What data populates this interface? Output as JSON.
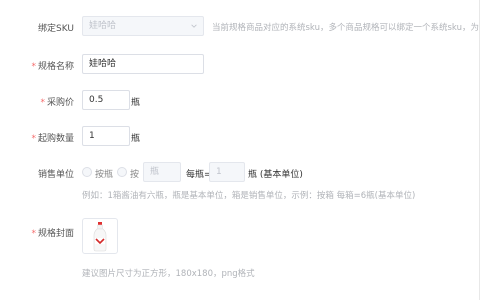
{
  "form": {
    "sku": {
      "label": "绑定SKU",
      "value": "娃哈哈",
      "hint": "当前规格商品对应的系统sku，多个商品规格可以绑定一个系统sku，为"
    },
    "spec_name": {
      "label": "规格名称",
      "value": "娃哈哈"
    },
    "purchase_price": {
      "label": "采购价",
      "value": "0.5",
      "unit": "瓶"
    },
    "min_qty": {
      "label": "起购数量",
      "value": "1",
      "unit": "瓶"
    },
    "sales_unit": {
      "label": "销售单位",
      "option_by_bottle": "按瓶",
      "option_by": "按",
      "box_placeholder": "瓶",
      "per_bottle_label": "每瓶=",
      "base_qty": "1",
      "base_suffix": "瓶 (基本单位)",
      "example": "例如：1箱酱油有六瓶，瓶是基本单位，箱是销售单位，示例：按箱 每箱=6瓶(基本单位)"
    },
    "cover": {
      "label": "规格封面",
      "hint": "建议图片尺寸为正方形，180x180，png格式"
    }
  },
  "colors": {
    "required": "#f56c6c",
    "border": "#dcdfe6",
    "hint": "#b0b3b8"
  },
  "icons": {
    "select_arrow": "chevron-down-icon",
    "cover": "bottle-image"
  }
}
